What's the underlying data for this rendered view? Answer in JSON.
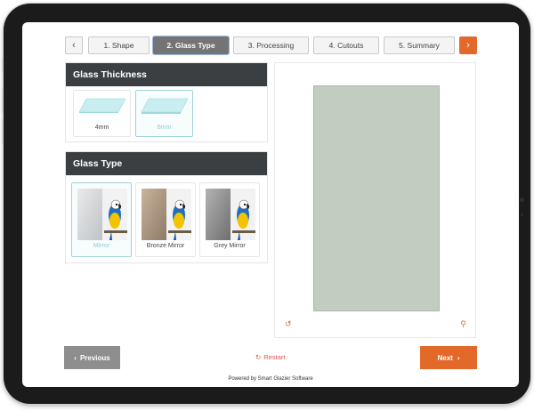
{
  "steps": [
    {
      "label": "1. Shape"
    },
    {
      "label": "2. Glass Type"
    },
    {
      "label": "3. Processing"
    },
    {
      "label": "4. Cutouts"
    },
    {
      "label": "5. Summary"
    }
  ],
  "nav": {
    "prev_icon": "chevron-left-icon",
    "next_icon": "chevron-right-icon"
  },
  "thickness": {
    "title": "Glass Thickness",
    "options": [
      {
        "label": "4mm",
        "selected": false
      },
      {
        "label": "6mm",
        "selected": true
      }
    ]
  },
  "glass_type": {
    "title": "Glass Type",
    "options": [
      {
        "label": "Mirror",
        "selected": true
      },
      {
        "label": "Bronze Mirror",
        "selected": false
      },
      {
        "label": "Grey Mirror",
        "selected": false
      }
    ]
  },
  "preview": {
    "glass_color": "#c3ccc1",
    "rotate_icon": "rotate-icon",
    "zoom_icon": "zoom-icon"
  },
  "footer": {
    "previous_label": "Previous",
    "restart_label": "Restart",
    "next_label": "Next",
    "powered_by": "Powered by Smart Glazier Software"
  },
  "colors": {
    "accent": "#e3692a",
    "header": "#3b3f42",
    "selected": "#9fd4d8"
  }
}
